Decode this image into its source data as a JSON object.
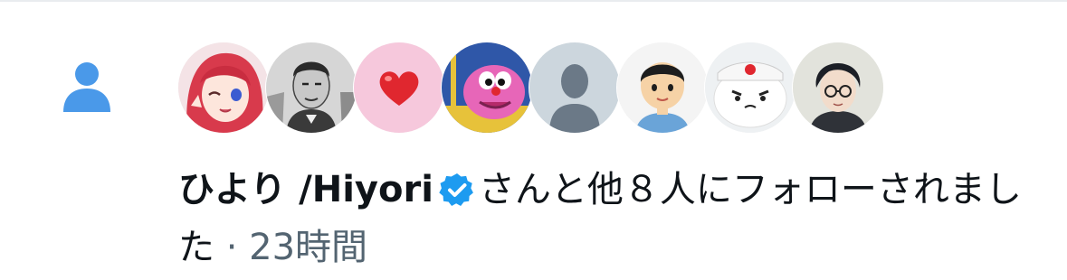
{
  "notification": {
    "icon": "person-icon",
    "icon_color": "#4a99e9",
    "avatars": [
      {
        "name": "avatar-anime-redhair"
      },
      {
        "name": "avatar-sketch-man"
      },
      {
        "name": "avatar-heart"
      },
      {
        "name": "avatar-pink-cartoon"
      },
      {
        "name": "avatar-default"
      },
      {
        "name": "avatar-cartoon-boy"
      },
      {
        "name": "avatar-white-dog"
      },
      {
        "name": "avatar-anime-glasses"
      }
    ],
    "user_name": "ひより /Hiyori",
    "verified_icon": "verified-badge-icon",
    "verified_color": "#1d9bf0",
    "message_text": "さんと他８人にフォローされました",
    "separator": "·",
    "timestamp": "23時間"
  }
}
